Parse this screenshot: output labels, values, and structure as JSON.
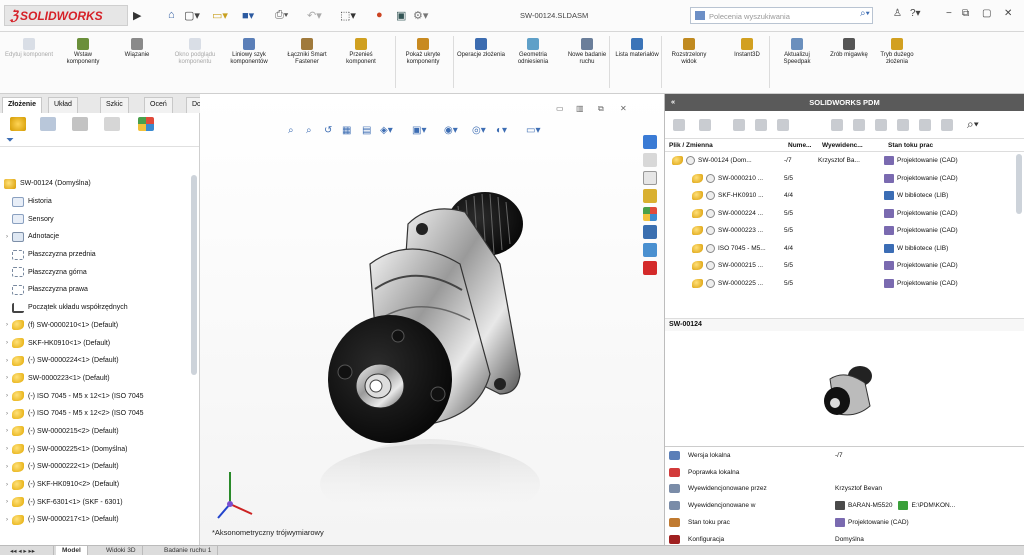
{
  "app": {
    "name": "SOLIDWORKS",
    "doc_title": "SW-00124.SLDASM"
  },
  "search": {
    "placeholder": "Polecenia wyszukiwania"
  },
  "ribbon": [
    {
      "label": "Edytuj komponent",
      "disabled": true,
      "color": "#9aa9c0"
    },
    {
      "label": "Wstaw komponenty",
      "disabled": false,
      "color": "#6a8f3a"
    },
    {
      "label": "Wiązanie",
      "disabled": false,
      "color": "#8a8a8a"
    },
    {
      "label": "Okno podglądu komponentu",
      "disabled": true,
      "color": "#9aa9c0"
    },
    {
      "label": "Liniowy szyk komponentów",
      "disabled": false,
      "color": "#5b7fb8"
    },
    {
      "label": "Łączniki Smart Fastener",
      "disabled": false,
      "color": "#a07a3c"
    },
    {
      "label": "Przenieś komponent",
      "disabled": false,
      "color": "#d0a020"
    },
    {
      "label": "Pokaż ukryte komponenty",
      "disabled": false,
      "color": "#c88a20"
    },
    {
      "label": "Operacje złożenia",
      "disabled": false,
      "color": "#3c6cb0"
    },
    {
      "label": "Geometria odniesienia",
      "disabled": false,
      "color": "#5fa0c8"
    },
    {
      "label": "Nowe badanie ruchu",
      "disabled": false,
      "color": "#6a7e9a"
    },
    {
      "label": "Lista materiałów",
      "disabled": false,
      "color": "#3b74b8"
    },
    {
      "label": "Rozstrzelony widok",
      "disabled": false,
      "color": "#c08a20"
    },
    {
      "label": "Instant3D",
      "disabled": false,
      "color": "#d2a020"
    },
    {
      "label": "Aktualizuj Speedpak",
      "disabled": false,
      "color": "#6a8fbd"
    },
    {
      "label": "Zrób migawkę",
      "disabled": false,
      "color": "#555555"
    },
    {
      "label": "Tryb dużego złożenia",
      "disabled": false,
      "color": "#d2a020"
    }
  ],
  "tabs": [
    "Złożenie",
    "Układ",
    "Szkic",
    "Oceń",
    "Dodatki SOLIDWORKS"
  ],
  "tree": [
    {
      "label": "SW-00124 (Domyślna)",
      "icon": "asm",
      "arrow": false,
      "indent": 0
    },
    {
      "label": "Historia",
      "icon": "doc",
      "arrow": false,
      "indent": 1
    },
    {
      "label": "Sensory",
      "icon": "doc",
      "arrow": false,
      "indent": 1
    },
    {
      "label": "Adnotacje",
      "icon": "ann",
      "arrow": true,
      "indent": 1
    },
    {
      "label": "Płaszczyzna przednia",
      "icon": "plane",
      "arrow": false,
      "indent": 1
    },
    {
      "label": "Płaszczyzna górna",
      "icon": "plane",
      "arrow": false,
      "indent": 1
    },
    {
      "label": "Płaszczyzna prawa",
      "icon": "plane",
      "arrow": false,
      "indent": 1
    },
    {
      "label": "Początek układu współrzędnych",
      "icon": "orig",
      "arrow": false,
      "indent": 1
    },
    {
      "label": "(f) SW-0000210<1> (Default)",
      "icon": "part",
      "arrow": true,
      "indent": 1
    },
    {
      "label": "SKF-HK0910<1> (Default)",
      "icon": "part",
      "arrow": true,
      "indent": 1
    },
    {
      "label": "(-) SW-0000224<1> (Default)",
      "icon": "part",
      "arrow": true,
      "indent": 1
    },
    {
      "label": "SW-0000223<1> (Default)",
      "icon": "part",
      "arrow": true,
      "indent": 1
    },
    {
      "label": "(-) ISO 7045 - M5 x 12<1> (ISO 7045",
      "icon": "part",
      "arrow": true,
      "indent": 1
    },
    {
      "label": "(-) ISO 7045 - M5 x 12<2> (ISO 7045",
      "icon": "part",
      "arrow": true,
      "indent": 1
    },
    {
      "label": "(-) SW-0000215<2> (Default)",
      "icon": "part",
      "arrow": true,
      "indent": 1
    },
    {
      "label": "(-) SW-0000225<1> (Domyślna)",
      "icon": "part",
      "arrow": true,
      "indent": 1
    },
    {
      "label": "(-) SW-0000222<1> (Default)",
      "icon": "part",
      "arrow": true,
      "indent": 1
    },
    {
      "label": "(-) SKF-HK0910<2> (Default)",
      "icon": "part",
      "arrow": true,
      "indent": 1
    },
    {
      "label": "(-) SKF-6301<1> (SKF - 6301)",
      "icon": "part",
      "arrow": true,
      "indent": 1
    },
    {
      "label": "(-) SW-0000217<1> (Default)",
      "icon": "part",
      "arrow": true,
      "indent": 1
    }
  ],
  "bottom_tabs": [
    "Model",
    "Widoki 3D",
    "Badanie ruchu 1"
  ],
  "viewport": {
    "caption": "*Aksonometryczny trójwymiarowy"
  },
  "pdm": {
    "title": "SOLIDWORKS PDM",
    "columns": [
      "Plik / Zmienna",
      "Nume...",
      "Wyewidenc...",
      "Stan toku prac"
    ],
    "rows": [
      {
        "name": "SW-00124 (Dom...",
        "num": "-/7",
        "user": "Krzysztof Ba...",
        "state": "Projektowanie (CAD)",
        "state_color": "#7a6ab0",
        "root": true
      },
      {
        "name": "SW-0000210 ...",
        "num": "5/5",
        "user": "",
        "state": "Projektowanie (CAD)",
        "state_color": "#7a6ab0",
        "root": false
      },
      {
        "name": "SKF-HK0910 ...",
        "num": "4/4",
        "user": "",
        "state": "W bibliotece (LIB)",
        "state_color": "#3b6db5",
        "root": false
      },
      {
        "name": "SW-0000224 ...",
        "num": "5/5",
        "user": "",
        "state": "Projektowanie (CAD)",
        "state_color": "#7a6ab0",
        "root": false
      },
      {
        "name": "SW-0000223 ...",
        "num": "5/5",
        "user": "",
        "state": "Projektowanie (CAD)",
        "state_color": "#7a6ab0",
        "root": false
      },
      {
        "name": "ISO 7045 - M5...",
        "num": "4/4",
        "user": "",
        "state": "W bibliotece (LIB)",
        "state_color": "#3b6db5",
        "root": false
      },
      {
        "name": "SW-0000215 ...",
        "num": "5/5",
        "user": "",
        "state": "Projektowanie (CAD)",
        "state_color": "#7a6ab0",
        "root": false
      },
      {
        "name": "SW-0000225 ...",
        "num": "5/5",
        "user": "",
        "state": "Projektowanie (CAD)",
        "state_color": "#7a6ab0",
        "root": false
      }
    ],
    "preview_label": "SW-00124",
    "properties": [
      {
        "key": "Wersja lokalna",
        "value": "-/7",
        "icon_color": "#5b7fb8",
        "value_icon": ""
      },
      {
        "key": "Poprawka lokalna",
        "value": "",
        "icon_color": "#d23a3a",
        "value_icon": ""
      },
      {
        "key": "Wyewidencjonowane przez",
        "value": "Krzysztof Bevan",
        "icon_color": "#7a8ca8",
        "value_icon": ""
      },
      {
        "key": "Wyewidencjonowane w",
        "value": "BARAN-M5520",
        "value2": "E:\\PDM\\KON...",
        "icon_color": "#7a8ca8",
        "value_icon": "#4a4a4a"
      },
      {
        "key": "Stan toku prac",
        "value": "Projektowanie (CAD)",
        "icon_color": "#c07a30",
        "value_icon": "#7a6ab0"
      },
      {
        "key": "Konfiguracja",
        "value": "Domyślna",
        "icon_color": "#a02020",
        "value_icon": ""
      }
    ]
  }
}
